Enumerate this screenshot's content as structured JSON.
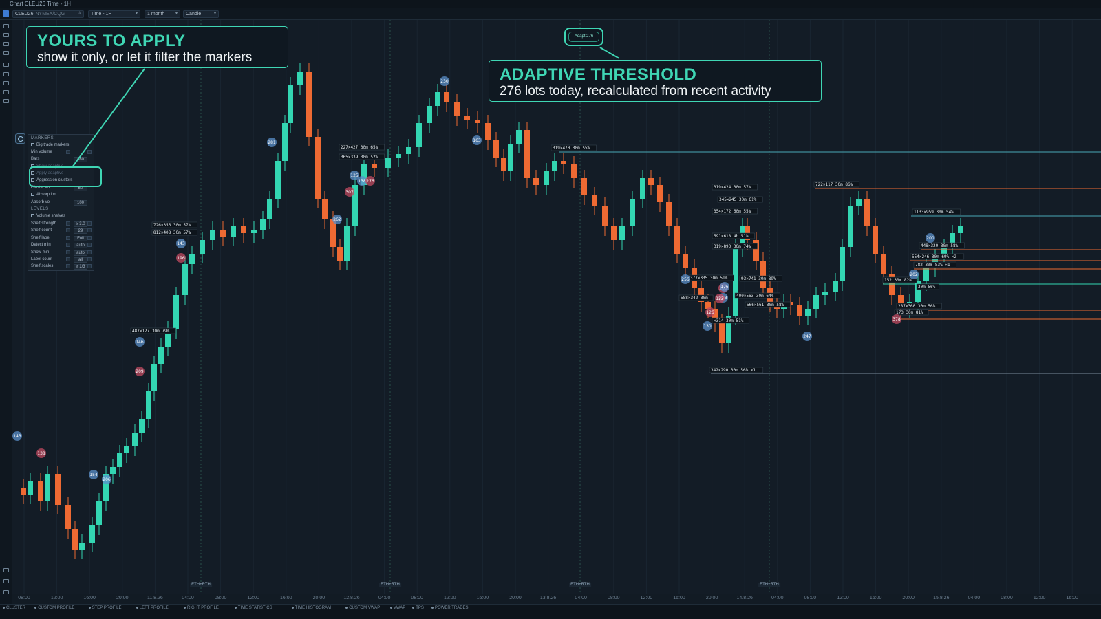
{
  "window": {
    "title": "Chart CLEU26 Time - 1H"
  },
  "toolbar": {
    "symbol": "CLEU26",
    "symbol_exchange": "NYMEX/CQG",
    "timeframe": "Time - 1H",
    "range": "1 month",
    "chart_type": "Candle"
  },
  "colors": {
    "bull": "#33d6b2",
    "bear": "#ee6a33",
    "accent": "#3fd6b4",
    "background": "#131c26",
    "buy_marker": "#5b8fc9",
    "sell_marker": "#c24a60"
  },
  "callouts": {
    "apply": {
      "title": "YOURS TO APPLY",
      "subtitle": "show it only, or let it filter the markers"
    },
    "threshold": {
      "title": "ADAPTIVE THRESHOLD",
      "subtitle": "276 lots today, recalculated from recent activity"
    },
    "adapt_badge": "Adapt 276"
  },
  "panel": {
    "markers_header": "MARKERS",
    "big_trade_markers": "Big trade markers",
    "min_volume_label": "Min volume",
    "bars_label": "Bars",
    "bars_value": "480",
    "show_adaptive": "Show adaptive",
    "apply_adaptive": "Apply adaptive",
    "aggression_clusters": "Aggression clusters",
    "cluster_vol_label": "Cluster vol",
    "cluster_vol_value": "50",
    "absorption": "Absorption",
    "absorb_vol_label": "Absorb vol",
    "absorb_vol_value": "100",
    "levels_header": "LEVELS",
    "volume_shelves": "Volume shelves",
    "rows": [
      {
        "label": "Shelf strength",
        "value": "≥ 3.0"
      },
      {
        "label": "Shelf count",
        "value": "29"
      },
      {
        "label": "Shelf label",
        "value": "Full"
      },
      {
        "label": "Detect min",
        "value": "auto"
      },
      {
        "label": "Show min",
        "value": "auto"
      },
      {
        "label": "Label count",
        "value": "all"
      },
      {
        "label": "Shelf scales",
        "value": "≥ 1/3"
      }
    ]
  },
  "x_axis": {
    "ticks": [
      "08:00",
      "12:00",
      "16:00",
      "20:00",
      "11.8.26",
      "04:00",
      "08:00",
      "12:00",
      "16:00",
      "20:00",
      "12.8.26",
      "04:00",
      "08:00",
      "12:00",
      "16:00",
      "20:00",
      "13.8.26",
      "04:00",
      "08:00",
      "12:00",
      "16:00",
      "20:00",
      "14.8.26",
      "04:00",
      "08:00",
      "12:00",
      "16:00",
      "20:00",
      "15.8.26",
      "04:00",
      "08:00",
      "12:00",
      "16:00"
    ],
    "session_label": "ETH+RTH"
  },
  "bottom_tabs": [
    "CLUSTER",
    "CUSTOM PROFILE",
    "STEP PROFILE",
    "LEFT PROFILE",
    "RIGHT PROFILE",
    "TIME STATISTICS",
    "TIME HISTOGRAM",
    "CUSTOM VWAP",
    "VWAP",
    "TPS",
    "POWER TRADES"
  ],
  "shelf_labels": [
    "726×356 30m 57%",
    "812×408 30m 57%",
    "487×127 30m 79%",
    "227×427 30m 65%",
    "365×339 30m 52%",
    "319×470 30m 55%",
    "319×424 30m 57%",
    "345×245 30m 61%",
    "354×172 60m 55%",
    "591×618 4h 51%",
    "319×893 30m 74%",
    "377×335 30m 51%",
    "93×741 30m 89%",
    "588×342 30m",
    "400×563 30m 64%",
    "566×561 30m 58%",
    "×314 30m 51%",
    "342×290 30m 56% ×1",
    "722×117 30m 86%",
    "1133×959 30m 54%",
    "448×320 30m 58%",
    "554×246 30m 69% ×2",
    "782 30m 83% ×1",
    "152 30m 82%",
    "30m 56%",
    "287×360 30m 56%",
    "173 30m 81%"
  ],
  "marker_values": [
    "143",
    "138",
    "154",
    "206",
    "209",
    "146",
    "143",
    "196",
    "281",
    "262",
    "307",
    "125",
    "138",
    "276",
    "230",
    "163",
    "200",
    "176",
    "133",
    "122",
    "247",
    "202",
    "378",
    "200",
    "256",
    "126",
    "130"
  ]
}
